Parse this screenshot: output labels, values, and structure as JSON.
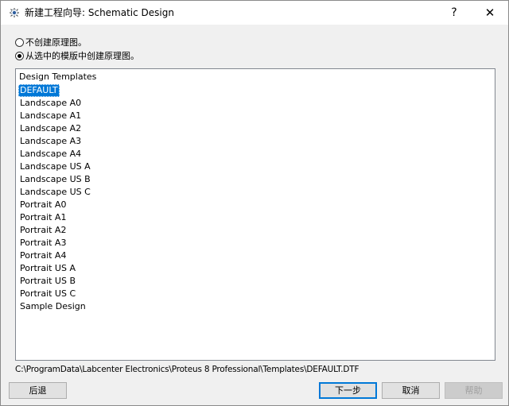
{
  "window": {
    "title": "新建工程向导: Schematic Design",
    "help_label": "?",
    "close_label": "✕"
  },
  "options": {
    "no_schematic": "不创建原理图。",
    "from_template": "从选中的模版中创建原理图。",
    "selected": "from_template"
  },
  "templates": {
    "header": "Design Templates",
    "items": [
      "DEFAULT",
      "Landscape A0",
      "Landscape A1",
      "Landscape A2",
      "Landscape A3",
      "Landscape A4",
      "Landscape US A",
      "Landscape US B",
      "Landscape US C",
      "Portrait A0",
      "Portrait A1",
      "Portrait A2",
      "Portrait A3",
      "Portrait A4",
      "Portrait US A",
      "Portrait US B",
      "Portrait US C",
      "Sample Design"
    ],
    "selected_index": 0
  },
  "path": "C:\\ProgramData\\Labcenter Electronics\\Proteus 8 Professional\\Templates\\DEFAULT.DTF",
  "buttons": {
    "back": "后退",
    "next": "下一步",
    "cancel": "取消",
    "help": "帮助"
  },
  "icons": {
    "app": "proteus-app-icon"
  }
}
